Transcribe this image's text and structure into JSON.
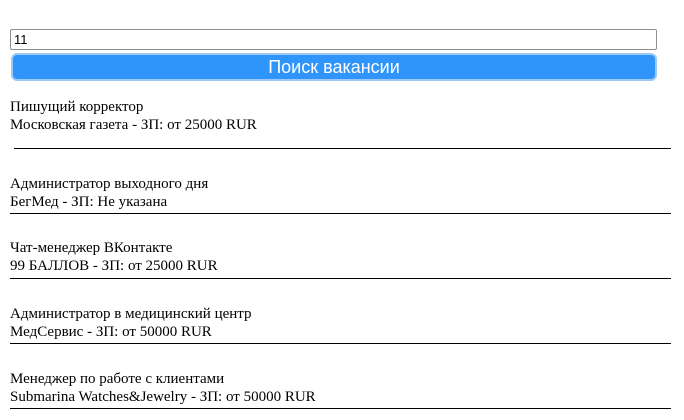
{
  "search": {
    "value": "11",
    "button_label": "Поиск вакансии"
  },
  "vacancies": [
    {
      "title": "Пишущий корректор",
      "employer": "Московская газета",
      "salary": "ЗП: от 25000 RUR",
      "meta": "Московская газета - ЗП: от 25000 RUR"
    },
    {
      "title": "Администратор выходного дня",
      "employer": "БегМед",
      "salary": "ЗП: Не указана",
      "meta": "БегМед - ЗП: Не указана"
    },
    {
      "title": "Чат-менеджер ВКонтакте",
      "employer": "99 БАЛЛОВ",
      "salary": "ЗП: от 25000 RUR",
      "meta": "99 БАЛЛОВ - ЗП: от 25000 RUR"
    },
    {
      "title": "Администратор в медицинский центр",
      "employer": "МедСервис",
      "salary": "ЗП: от 50000 RUR",
      "meta": "МедСервис - ЗП: от 50000 RUR"
    },
    {
      "title": "Менеджер по работе с клиентами",
      "employer": "Submarina Watches&Jewelry",
      "salary": "ЗП: от 50000 RUR",
      "meta": "Submarina Watches&Jewelry - ЗП: от 50000 RUR"
    }
  ],
  "colors": {
    "button_bg": "#2f95fb",
    "button_border": "#9ec9f7",
    "button_text": "#ffffff",
    "divider": "#000000"
  }
}
